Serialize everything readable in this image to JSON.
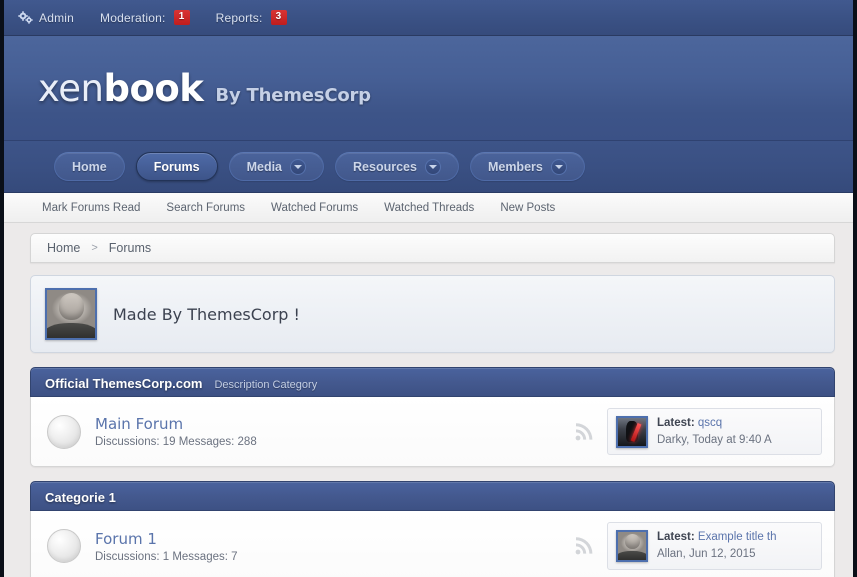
{
  "adminbar": {
    "admin_label": "Admin",
    "admin_icon": "gears-icon",
    "moderation_label": "Moderation:",
    "moderation_count": "1",
    "reports_label": "Reports:",
    "reports_count": "3",
    "badge_color": "#cf2222"
  },
  "header": {
    "logo_part1": "xen",
    "logo_part2": "book",
    "logo_tagline": "By ThemesCorp",
    "background_color": "#465f95"
  },
  "nav": {
    "tabs": [
      {
        "label": "Home",
        "selected": false,
        "has_caret": false
      },
      {
        "label": "Forums",
        "selected": true,
        "has_caret": false
      },
      {
        "label": "Media",
        "selected": false,
        "has_caret": true
      },
      {
        "label": "Resources",
        "selected": false,
        "has_caret": true
      },
      {
        "label": "Members",
        "selected": false,
        "has_caret": true
      }
    ]
  },
  "subnav": {
    "links": [
      "Mark Forums Read",
      "Search Forums",
      "Watched Forums",
      "Watched Threads",
      "New Posts"
    ]
  },
  "breadcrumb": {
    "items": [
      "Home",
      "Forums"
    ],
    "separator": ">"
  },
  "notice": {
    "text": "Made By ThemesCorp !",
    "avatar": "user-photo-avatar"
  },
  "categories": [
    {
      "title": "Official ThemesCorp.com",
      "description": "Description Category",
      "forums": [
        {
          "title": "Main Forum",
          "stats": "Discussions: 19 Messages: 288",
          "rss_icon": "rss-icon",
          "last_post": {
            "avatar": "dark-warrior-avatar",
            "label": "Latest:",
            "thread": "qscq",
            "meta": "Darky, Today at 9:40 A"
          }
        }
      ]
    },
    {
      "title": "Categorie 1",
      "description": "",
      "forums": [
        {
          "title": "Forum 1",
          "stats": "Discussions: 1 Messages: 7",
          "rss_icon": "rss-icon",
          "last_post": {
            "avatar": "user-photo-avatar",
            "label": "Latest:",
            "thread": "Example title th",
            "meta": "Allan, Jun 12, 2015"
          }
        }
      ]
    }
  ]
}
